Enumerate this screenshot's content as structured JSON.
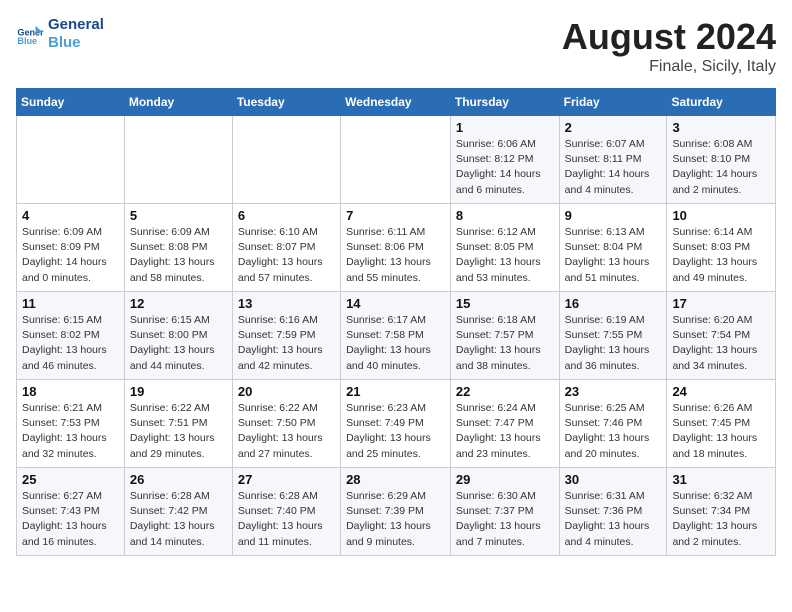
{
  "logo": {
    "line1": "General",
    "line2": "Blue"
  },
  "title": "August 2024",
  "subtitle": "Finale, Sicily, Italy",
  "days_of_week": [
    "Sunday",
    "Monday",
    "Tuesday",
    "Wednesday",
    "Thursday",
    "Friday",
    "Saturday"
  ],
  "weeks": [
    [
      {
        "day": "",
        "info": ""
      },
      {
        "day": "",
        "info": ""
      },
      {
        "day": "",
        "info": ""
      },
      {
        "day": "",
        "info": ""
      },
      {
        "day": "1",
        "info": "Sunrise: 6:06 AM\nSunset: 8:12 PM\nDaylight: 14 hours\nand 6 minutes."
      },
      {
        "day": "2",
        "info": "Sunrise: 6:07 AM\nSunset: 8:11 PM\nDaylight: 14 hours\nand 4 minutes."
      },
      {
        "day": "3",
        "info": "Sunrise: 6:08 AM\nSunset: 8:10 PM\nDaylight: 14 hours\nand 2 minutes."
      }
    ],
    [
      {
        "day": "4",
        "info": "Sunrise: 6:09 AM\nSunset: 8:09 PM\nDaylight: 14 hours\nand 0 minutes."
      },
      {
        "day": "5",
        "info": "Sunrise: 6:09 AM\nSunset: 8:08 PM\nDaylight: 13 hours\nand 58 minutes."
      },
      {
        "day": "6",
        "info": "Sunrise: 6:10 AM\nSunset: 8:07 PM\nDaylight: 13 hours\nand 57 minutes."
      },
      {
        "day": "7",
        "info": "Sunrise: 6:11 AM\nSunset: 8:06 PM\nDaylight: 13 hours\nand 55 minutes."
      },
      {
        "day": "8",
        "info": "Sunrise: 6:12 AM\nSunset: 8:05 PM\nDaylight: 13 hours\nand 53 minutes."
      },
      {
        "day": "9",
        "info": "Sunrise: 6:13 AM\nSunset: 8:04 PM\nDaylight: 13 hours\nand 51 minutes."
      },
      {
        "day": "10",
        "info": "Sunrise: 6:14 AM\nSunset: 8:03 PM\nDaylight: 13 hours\nand 49 minutes."
      }
    ],
    [
      {
        "day": "11",
        "info": "Sunrise: 6:15 AM\nSunset: 8:02 PM\nDaylight: 13 hours\nand 46 minutes."
      },
      {
        "day": "12",
        "info": "Sunrise: 6:15 AM\nSunset: 8:00 PM\nDaylight: 13 hours\nand 44 minutes."
      },
      {
        "day": "13",
        "info": "Sunrise: 6:16 AM\nSunset: 7:59 PM\nDaylight: 13 hours\nand 42 minutes."
      },
      {
        "day": "14",
        "info": "Sunrise: 6:17 AM\nSunset: 7:58 PM\nDaylight: 13 hours\nand 40 minutes."
      },
      {
        "day": "15",
        "info": "Sunrise: 6:18 AM\nSunset: 7:57 PM\nDaylight: 13 hours\nand 38 minutes."
      },
      {
        "day": "16",
        "info": "Sunrise: 6:19 AM\nSunset: 7:55 PM\nDaylight: 13 hours\nand 36 minutes."
      },
      {
        "day": "17",
        "info": "Sunrise: 6:20 AM\nSunset: 7:54 PM\nDaylight: 13 hours\nand 34 minutes."
      }
    ],
    [
      {
        "day": "18",
        "info": "Sunrise: 6:21 AM\nSunset: 7:53 PM\nDaylight: 13 hours\nand 32 minutes."
      },
      {
        "day": "19",
        "info": "Sunrise: 6:22 AM\nSunset: 7:51 PM\nDaylight: 13 hours\nand 29 minutes."
      },
      {
        "day": "20",
        "info": "Sunrise: 6:22 AM\nSunset: 7:50 PM\nDaylight: 13 hours\nand 27 minutes."
      },
      {
        "day": "21",
        "info": "Sunrise: 6:23 AM\nSunset: 7:49 PM\nDaylight: 13 hours\nand 25 minutes."
      },
      {
        "day": "22",
        "info": "Sunrise: 6:24 AM\nSunset: 7:47 PM\nDaylight: 13 hours\nand 23 minutes."
      },
      {
        "day": "23",
        "info": "Sunrise: 6:25 AM\nSunset: 7:46 PM\nDaylight: 13 hours\nand 20 minutes."
      },
      {
        "day": "24",
        "info": "Sunrise: 6:26 AM\nSunset: 7:45 PM\nDaylight: 13 hours\nand 18 minutes."
      }
    ],
    [
      {
        "day": "25",
        "info": "Sunrise: 6:27 AM\nSunset: 7:43 PM\nDaylight: 13 hours\nand 16 minutes."
      },
      {
        "day": "26",
        "info": "Sunrise: 6:28 AM\nSunset: 7:42 PM\nDaylight: 13 hours\nand 14 minutes."
      },
      {
        "day": "27",
        "info": "Sunrise: 6:28 AM\nSunset: 7:40 PM\nDaylight: 13 hours\nand 11 minutes."
      },
      {
        "day": "28",
        "info": "Sunrise: 6:29 AM\nSunset: 7:39 PM\nDaylight: 13 hours\nand 9 minutes."
      },
      {
        "day": "29",
        "info": "Sunrise: 6:30 AM\nSunset: 7:37 PM\nDaylight: 13 hours\nand 7 minutes."
      },
      {
        "day": "30",
        "info": "Sunrise: 6:31 AM\nSunset: 7:36 PM\nDaylight: 13 hours\nand 4 minutes."
      },
      {
        "day": "31",
        "info": "Sunrise: 6:32 AM\nSunset: 7:34 PM\nDaylight: 13 hours\nand 2 minutes."
      }
    ]
  ]
}
